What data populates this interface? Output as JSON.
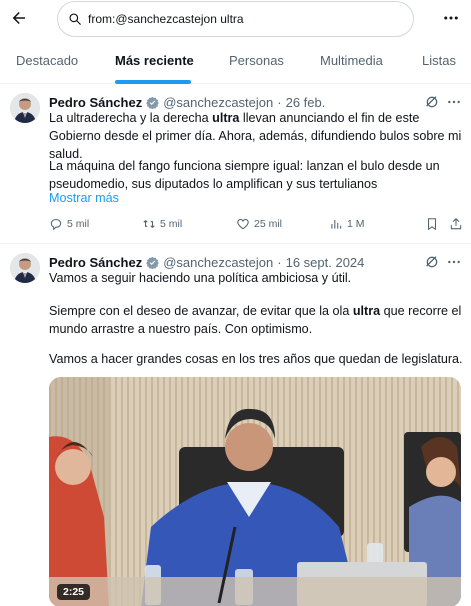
{
  "search": {
    "query": "from:@sanchezcastejon ultra"
  },
  "tabs": [
    {
      "label": "Destacado"
    },
    {
      "label": "Más reciente"
    },
    {
      "label": "Personas"
    },
    {
      "label": "Multimedia"
    },
    {
      "label": "Listas"
    }
  ],
  "active_tab": "Más reciente",
  "colors": {
    "accent": "#1d9bf0",
    "text": "#0f1419",
    "muted": "#536471",
    "divider": "#eff3f4"
  },
  "tweets": [
    {
      "name": "Pedro Sánchez",
      "handle": "@sanchezcastejon",
      "separator": "·",
      "date": "26 feb.",
      "p1_a": "La ultraderecha y la derecha ",
      "p1_b": "ultra",
      "p1_c": " llevan anunciando el fin de este Gobierno desde el primer día. Ahora, además, difundiendo bulos sobre mi salud.",
      "p2": "La máquina del fango funciona siempre igual: lanzan el bulo desde un pseudomedio, sus diputados lo amplifican y sus tertulianos",
      "show_more": "Mostrar más",
      "replies": "5 mil",
      "reposts": "5 mil",
      "likes": "25 mil",
      "views": "1 M"
    },
    {
      "name": "Pedro Sánchez",
      "handle": "@sanchezcastejon",
      "separator": "·",
      "date": "16 sept. 2024",
      "p1": "Vamos a seguir haciendo una política ambiciosa y útil.",
      "p2_a": "Siempre con el deseo de avanzar, de evitar que la ola ",
      "p2_b": "ultra",
      "p2_c": " que recorre el mundo arrastre a nuestro país. Con optimismo.",
      "p3": "Vamos a hacer grandes cosas en los tres años que quedan de legislatura.",
      "video_duration": "2:25"
    }
  ]
}
